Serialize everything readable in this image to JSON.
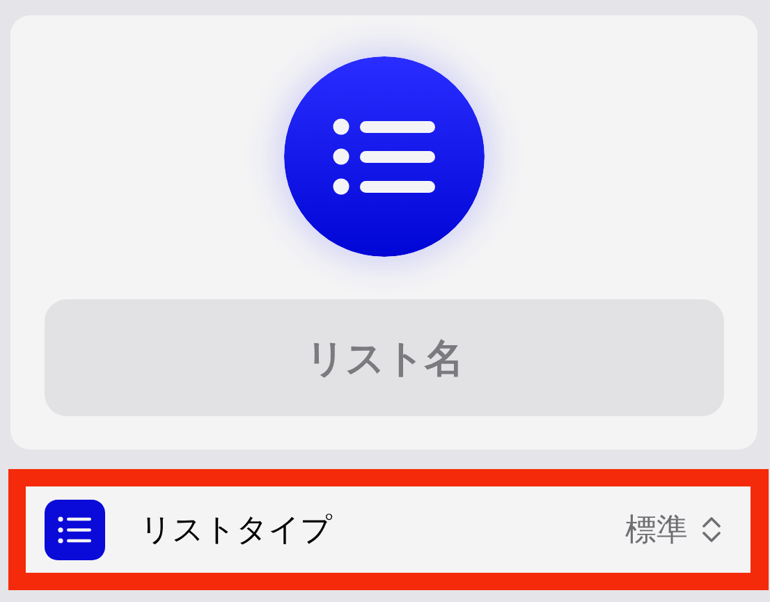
{
  "list_name_field": {
    "placeholder": "リスト名"
  },
  "settings": [
    {
      "kind": "picker",
      "label": "リストタイプ",
      "value": "標準",
      "highlighted": true
    }
  ]
}
